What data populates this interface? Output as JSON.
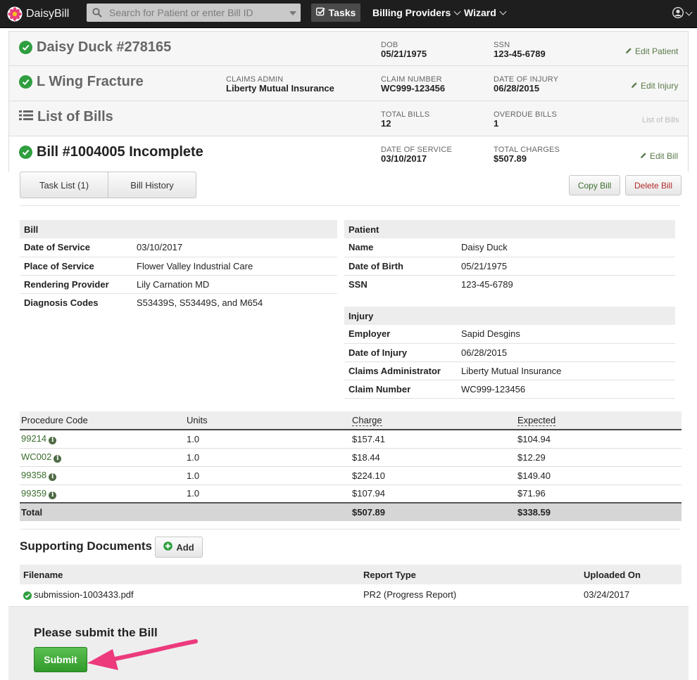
{
  "nav": {
    "brand": "DaisyBill",
    "search_placeholder": "Search for Patient or enter Bill ID",
    "tasks": "Tasks",
    "billing_providers": "Billing Providers",
    "wizard": "Wizard"
  },
  "patient_row": {
    "title": "Daisy Duck #278165",
    "dob_label": "DOB",
    "dob": "05/21/1975",
    "ssn_label": "SSN",
    "ssn": "123-45-6789",
    "edit": "Edit Patient"
  },
  "injury_row": {
    "title": "L Wing Fracture",
    "claims_admin_label": "CLAIMS ADMIN",
    "claims_admin": "Liberty Mutual Insurance",
    "claim_number_label": "CLAIM NUMBER",
    "claim_number": "WC999-123456",
    "doi_label": "DATE OF INJURY",
    "doi": "06/28/2015",
    "edit": "Edit Injury"
  },
  "bills_row": {
    "title": "List of Bills",
    "total_label": "TOTAL BILLS",
    "total": "12",
    "overdue_label": "OVERDUE BILLS",
    "overdue": "1",
    "link": "List of Bills"
  },
  "bill_row": {
    "title": "Bill #1004005 Incomplete",
    "dos_label": "DATE OF SERVICE",
    "dos": "03/10/2017",
    "charges_label": "TOTAL CHARGES",
    "charges": "$507.89",
    "edit": "Edit Bill"
  },
  "tabs": {
    "task_list": "Task List (1)",
    "bill_history": "Bill History"
  },
  "actions": {
    "copy": "Copy Bill",
    "delete": "Delete Bill"
  },
  "bill_info": {
    "heading": "Bill",
    "rows": [
      {
        "k": "Date of Service",
        "v": "03/10/2017"
      },
      {
        "k": "Place of Service",
        "v": "Flower Valley Industrial Care"
      },
      {
        "k": "Rendering Provider",
        "v": "Lily Carnation MD"
      },
      {
        "k": "Diagnosis Codes",
        "v": "S53439S, S53449S, and M654"
      }
    ]
  },
  "patient_info": {
    "heading": "Patient",
    "rows": [
      {
        "k": "Name",
        "v": "Daisy Duck"
      },
      {
        "k": "Date of Birth",
        "v": "05/21/1975"
      },
      {
        "k": "SSN",
        "v": "123-45-6789"
      }
    ]
  },
  "injury_info": {
    "heading": "Injury",
    "rows": [
      {
        "k": "Employer",
        "v": "Sapid Desgins"
      },
      {
        "k": "Date of Injury",
        "v": "06/28/2015"
      },
      {
        "k": "Claims Administrator",
        "v": "Liberty Mutual Insurance"
      },
      {
        "k": "Claim Number",
        "v": "WC999-123456"
      }
    ]
  },
  "procedures": {
    "headers": [
      "Procedure Code",
      "Units",
      "Charge",
      "Expected"
    ],
    "rows": [
      {
        "code": "99214",
        "units": "1.0",
        "charge": "$157.41",
        "expected": "$104.94"
      },
      {
        "code": "WC002",
        "units": "1.0",
        "charge": "$18.44",
        "expected": "$12.29"
      },
      {
        "code": "99358",
        "units": "1.0",
        "charge": "$224.10",
        "expected": "$149.40"
      },
      {
        "code": "99359",
        "units": "1.0",
        "charge": "$107.94",
        "expected": "$71.96"
      }
    ],
    "total_label": "Total",
    "total_charge": "$507.89",
    "total_expected": "$338.59"
  },
  "documents": {
    "heading": "Supporting Documents",
    "add": "Add",
    "headers": [
      "Filename",
      "Report Type",
      "Uploaded On"
    ],
    "rows": [
      {
        "filename": "submission-1003433.pdf",
        "type": "PR2 (Progress Report)",
        "date": "03/24/2017"
      }
    ]
  },
  "submit": {
    "prompt": "Please submit the Bill",
    "button": "Submit"
  },
  "colors": {
    "nav_bg": "#1e1e1e",
    "success_green": "#2f9e3f",
    "link_green": "#3b6e2e",
    "delete_red": "#b52a2a",
    "arrow_pink": "#ec3a7d"
  }
}
